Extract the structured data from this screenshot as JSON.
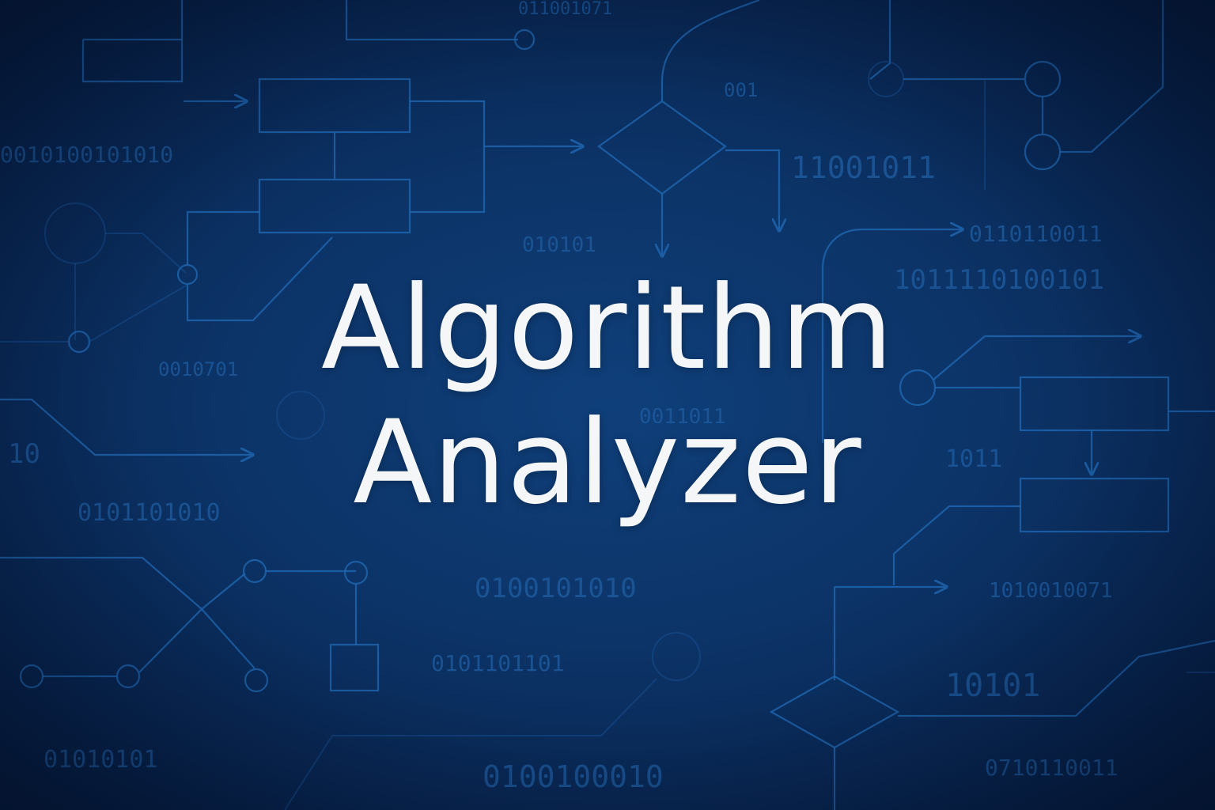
{
  "title": {
    "line1": "Algorithm",
    "line2": "Analyzer"
  },
  "background": {
    "binary_strings": [
      "011001071",
      "0010100101010",
      "001",
      "11001011",
      "010101",
      "0110110011",
      "1011110100101",
      "0010701",
      "0011011",
      "10",
      "0101101010",
      "1011",
      "0100101010",
      "1010010071",
      "10101",
      "01010101",
      "0100100010",
      "0710110011",
      "0101101101"
    ]
  },
  "colors": {
    "background": "#0c3468",
    "line": "#1f64ad",
    "title_text": "#f4f6f8"
  }
}
